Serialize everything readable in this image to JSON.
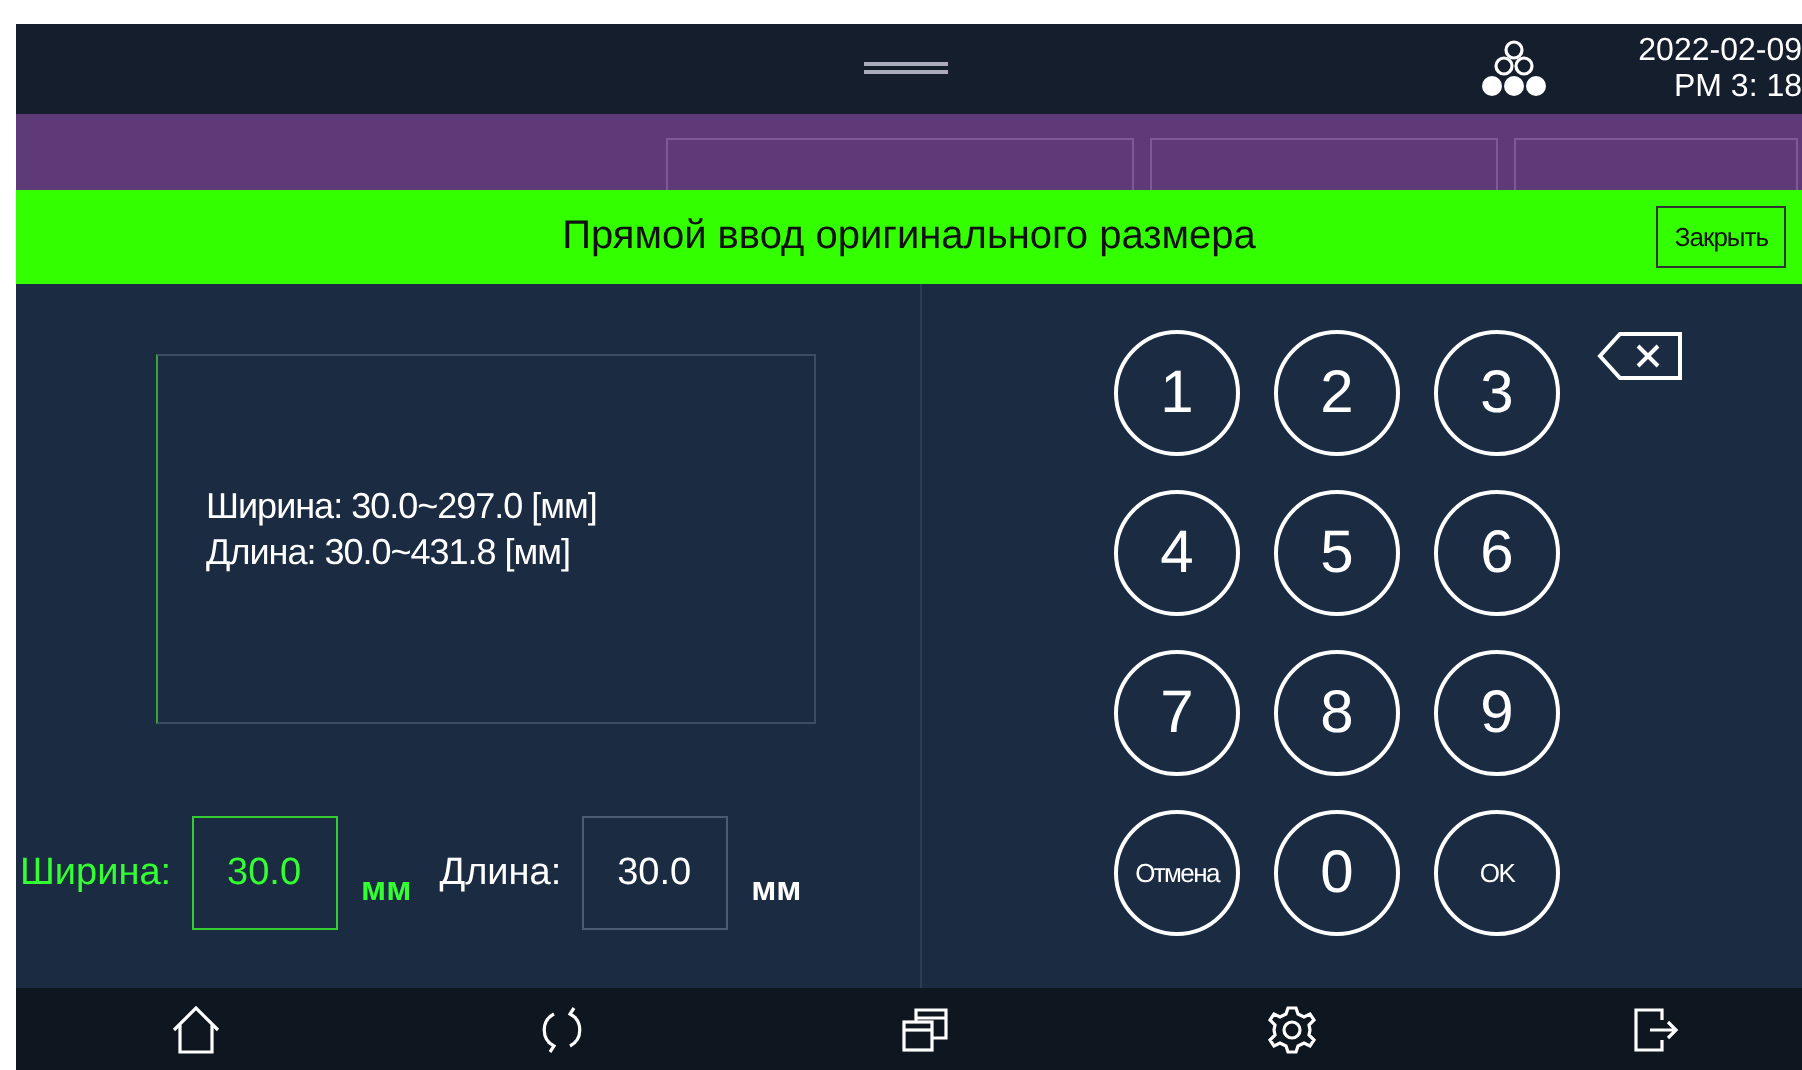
{
  "status_bar": {
    "date": "2022-02-09",
    "time": "PM 3: 18"
  },
  "dialog": {
    "title": "Прямой ввод оригинального размера",
    "close_button": "Закрыть",
    "range_lines": [
      "Ширина: 30.0~297.0 [мм]",
      "Длина: 30.0~431.8 [мм]"
    ],
    "fields": [
      {
        "label": "Ширина:",
        "value": "30.0",
        "unit": "мм",
        "selected": true
      },
      {
        "label": "Длина:",
        "value": "30.0",
        "unit": "мм",
        "selected": false
      }
    ],
    "keypad": [
      {
        "label": "1",
        "kind": "digit"
      },
      {
        "label": "2",
        "kind": "digit"
      },
      {
        "label": "3",
        "kind": "digit"
      },
      {
        "label": "4",
        "kind": "digit"
      },
      {
        "label": "5",
        "kind": "digit"
      },
      {
        "label": "6",
        "kind": "digit"
      },
      {
        "label": "7",
        "kind": "digit"
      },
      {
        "label": "8",
        "kind": "digit"
      },
      {
        "label": "9",
        "kind": "digit"
      },
      {
        "label": "Отмена",
        "kind": "small"
      },
      {
        "label": "0",
        "kind": "digit"
      },
      {
        "label": "OK",
        "kind": "small"
      }
    ]
  }
}
